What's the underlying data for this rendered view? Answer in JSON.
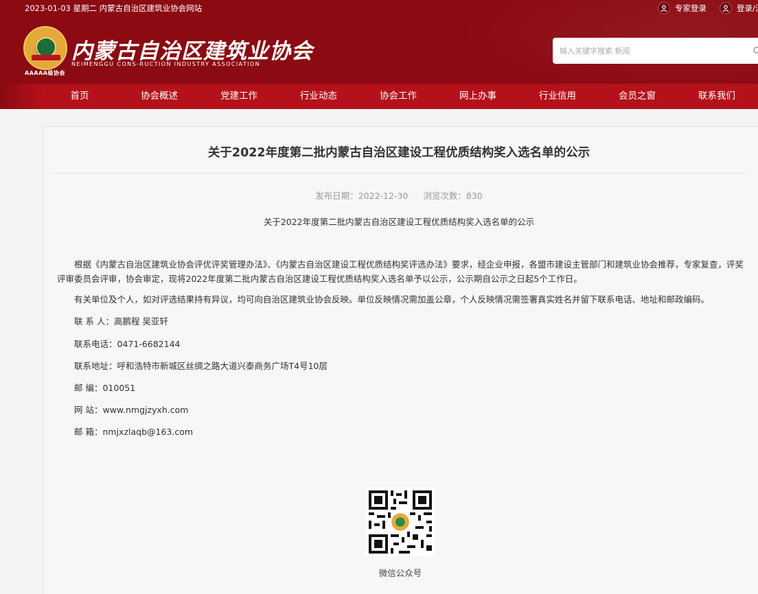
{
  "topbar": {
    "date_line": "2023-01-03 星期二   内蒙古自治区建筑业协会网站",
    "expert_login": "专家登录",
    "login_register": "登录/注"
  },
  "brand": {
    "name_cn": "内蒙古自治区建筑业协会",
    "name_en": "NEIMENGGU CONS‑RUCTION INDUSTRY ASSOCIATION",
    "badge": "AAAAA级协会"
  },
  "search": {
    "placeholder": "输入关键字搜索 新闻"
  },
  "nav": {
    "items": [
      "首页",
      "协会概述",
      "党建工作",
      "行业动态",
      "协会工作",
      "网上办事",
      "行业信用",
      "会员之窗",
      "联系我们"
    ]
  },
  "article": {
    "title": "关于2022年度第二批内蒙古自治区建设工程优质结构奖入选名单的公示",
    "publish_date": "发布日期：2022-12-30",
    "views": "浏览次数：830",
    "subtitle": "关于2022年度第二批内蒙古自治区建设工程优质结构奖入选名单的公示",
    "para1": "根据《内蒙古自治区建筑业协会评优评奖管理办法》、《内蒙古自治区建设工程优质结构奖评选办法》要求，经企业申报，各盟市建设主管部门和建筑业协会推荐，专家复查，评奖评审委员会评审，协会审定，现将2022年度第二批内蒙古自治区建设工程优质结构奖入选名单予以公示，公示期自公示之日起5个工作日。",
    "para2": "有关单位及个人，如对评选结果持有异议，均可向自治区建筑业协会反映。单位反映情况需加盖公章，个人反映情况需签署真实姓名并留下联系电话、地址和邮政编码。",
    "contact_person": "联 系 人：高鹏程  吴亚轩",
    "phone": "联系电话：0471-6682144",
    "address": "联系地址：呼和浩特市新城区丝绸之路大道兴泰商务广场T4号10层",
    "postcode": "邮    编：010051",
    "website": "网    站：www.nmgjzyxh.com",
    "email": "邮    箱：nmjxzlaqb@163.com",
    "qr_caption": "微信公众号"
  },
  "colors": {
    "header_bg": "#8c0a12",
    "nav_bg": "#b5111a",
    "page_bg": "#f4f4f4"
  }
}
